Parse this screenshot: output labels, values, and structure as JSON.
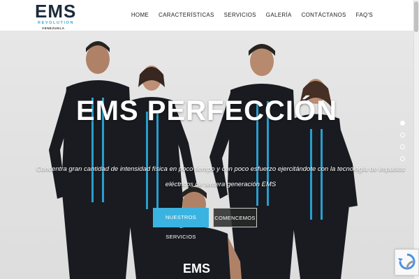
{
  "brand": {
    "logo_main": "EMS",
    "logo_sub": "REVOLUTION",
    "logo_country": "VENEZUELA"
  },
  "nav": {
    "items": [
      "HOME",
      "CARACTERÍSTICAS",
      "SERVICIOS",
      "GALERÍA",
      "CONTÁCTANOS",
      "FAQ'S"
    ]
  },
  "hero": {
    "title": "EMS PERFECCIÓN",
    "text_line1": "Concentra gran cantidad de intensidad física en poco tiempo y con poco esfuerzo ejercitándote con la tecnología de impulsos",
    "text_line2": "eléctricos de tercera generación EMS",
    "button_primary": "NUESTROS SERVICIOS",
    "button_secondary": "COMENCEMOS",
    "slide_count": 4,
    "active_slide": 1,
    "shirt_logo": "EMS"
  },
  "colors": {
    "accent": "#3bb3e1",
    "suit_dark": "#1b1d22",
    "suit_stripe": "#2aa8dc"
  }
}
